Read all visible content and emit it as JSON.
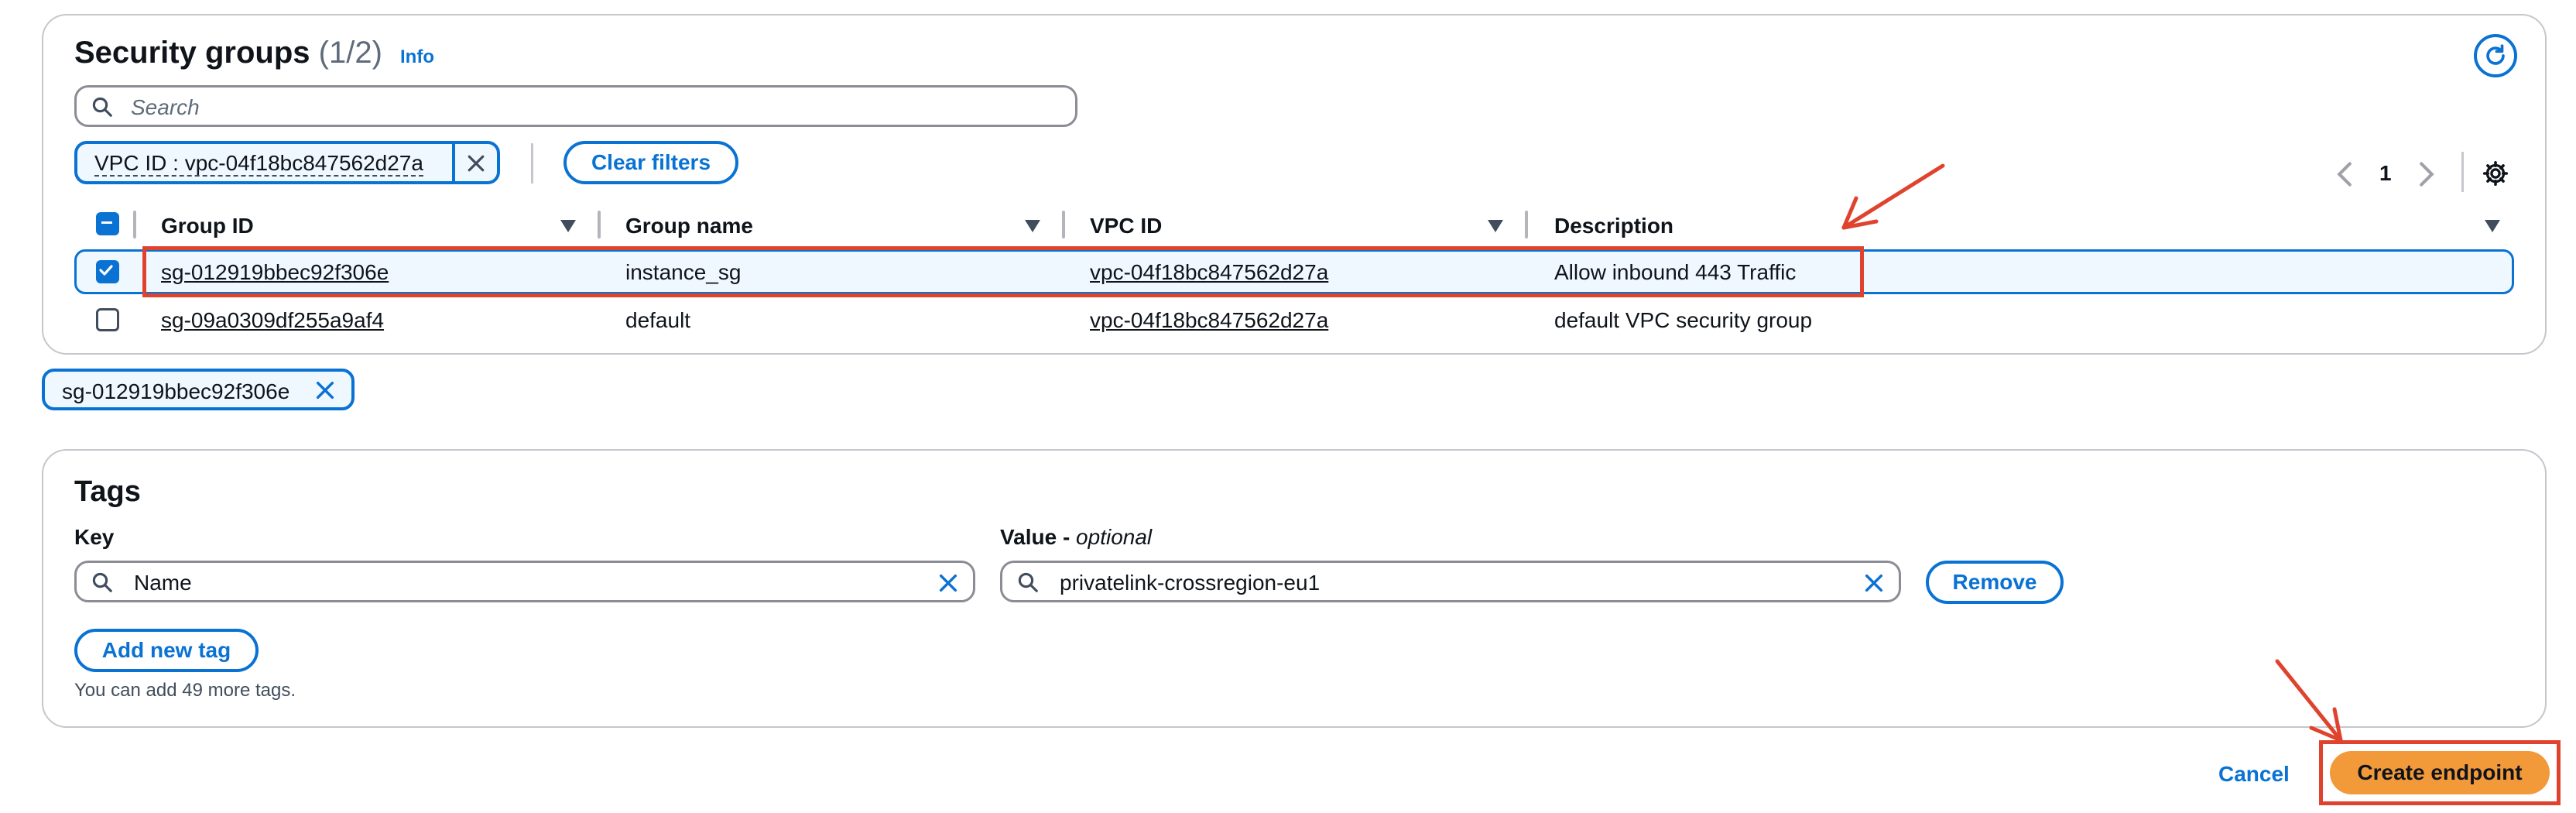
{
  "security_groups": {
    "title": "Security groups",
    "count": "(1/2)",
    "info": "Info",
    "search_placeholder": "Search",
    "filter_token": "VPC ID : vpc-04f18bc847562d27a",
    "clear_filters": "Clear filters",
    "page_number": "1",
    "columns": [
      "Group ID",
      "Group name",
      "VPC ID",
      "Description"
    ],
    "rows": [
      {
        "group_id": "sg-012919bbec92f306e",
        "group_name": "instance_sg",
        "vpc_id": "vpc-04f18bc847562d27a",
        "description": "Allow inbound 443 Traffic",
        "selected": true
      },
      {
        "group_id": "sg-09a0309df255a9af4",
        "group_name": "default",
        "vpc_id": "vpc-04f18bc847562d27a",
        "description": "default VPC security group",
        "selected": false
      }
    ],
    "selected_token": "sg-012919bbec92f306e"
  },
  "tags": {
    "title": "Tags",
    "key_label": "Key",
    "value_label": "Value - ",
    "value_optional": "optional",
    "key_value": "Name",
    "value_value": "privatelink-crossregion-eu1",
    "remove": "Remove",
    "add_new_tag": "Add new tag",
    "hint": "You can add 49 more tags."
  },
  "footer": {
    "cancel": "Cancel",
    "create_endpoint": "Create endpoint"
  },
  "colors": {
    "accent": "#0972d3",
    "annotation": "#e0432d",
    "primary_button": "#f2993a"
  }
}
